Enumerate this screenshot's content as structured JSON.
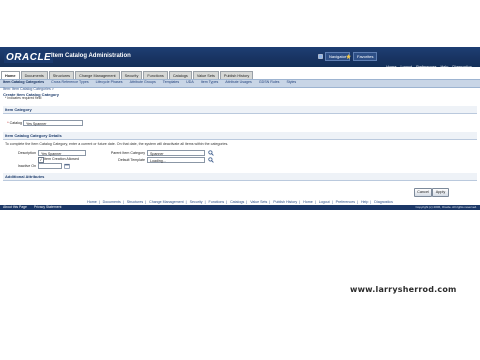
{
  "header": {
    "logo": "ORACLE",
    "app_title": "Item Catalog Administration",
    "navigator": "Navigator",
    "favorites": "Favorites",
    "links": [
      "Home",
      "Logout",
      "Preferences",
      "Help",
      "Diagnostics"
    ]
  },
  "tabs": [
    {
      "label": "Home"
    },
    {
      "label": "Documents"
    },
    {
      "label": "Structures"
    },
    {
      "label": "Change Management"
    },
    {
      "label": "Security"
    },
    {
      "label": "Functions"
    },
    {
      "label": "Catalogs"
    },
    {
      "label": "Value Sets"
    },
    {
      "label": "Publish History"
    }
  ],
  "subtabs": [
    {
      "label": "Item Catalog Categories"
    },
    {
      "label": "Cross Reference Types"
    },
    {
      "label": "Lifecycle Phases"
    },
    {
      "label": "Attribute Groups"
    },
    {
      "label": "Templates"
    },
    {
      "label": "UDA"
    },
    {
      "label": "Item Types"
    },
    {
      "label": "Attribute Usages"
    },
    {
      "label": "GDSN Rules"
    },
    {
      "label": "Styles"
    }
  ],
  "breadcrumb": "Item: Item Catalog Categories  >",
  "page_title": "Create Item Catalog Category",
  "required_note": "* Indicates required field",
  "section_item_category": "Item Category",
  "catalog": {
    "label": "Catalog",
    "value": "Yes Spanner"
  },
  "section_details": "Item Catalog Category Details",
  "instruction": "To complete the Item Catalog Category, enter a current or future date. On that date, the system will deactivate all items within the categories.",
  "description": {
    "label": "Description",
    "value": "Yes Spanner"
  },
  "item_creation_allowed": "Item Creation Allowed",
  "inactive_on": {
    "label": "Inactive On"
  },
  "parent_category": {
    "label": "Parent Item Category",
    "value": "Spanner"
  },
  "default_template": {
    "label": "Default Template",
    "value": "Loading..."
  },
  "section_additional": "Additional Attributes",
  "buttons": {
    "cancel": "Cancel",
    "apply": "Apply"
  },
  "footer_links": [
    "Home",
    "Documents",
    "Structures",
    "Change Management",
    "Security",
    "Functions",
    "Catalogs",
    "Value Sets",
    "Publish History",
    "Home",
    "Logout",
    "Preferences",
    "Help",
    "Diagnostics"
  ],
  "footer_left": [
    "About this Page",
    "Privacy Statement"
  ],
  "footer_copyright": "Copyright (c) 2006, Oracle. All rights reserved.",
  "watermark": "www.larrysherrod.com",
  "colors": {
    "header": "#183361",
    "subnav": "#c8d5e6",
    "link": "#2b4f88"
  }
}
